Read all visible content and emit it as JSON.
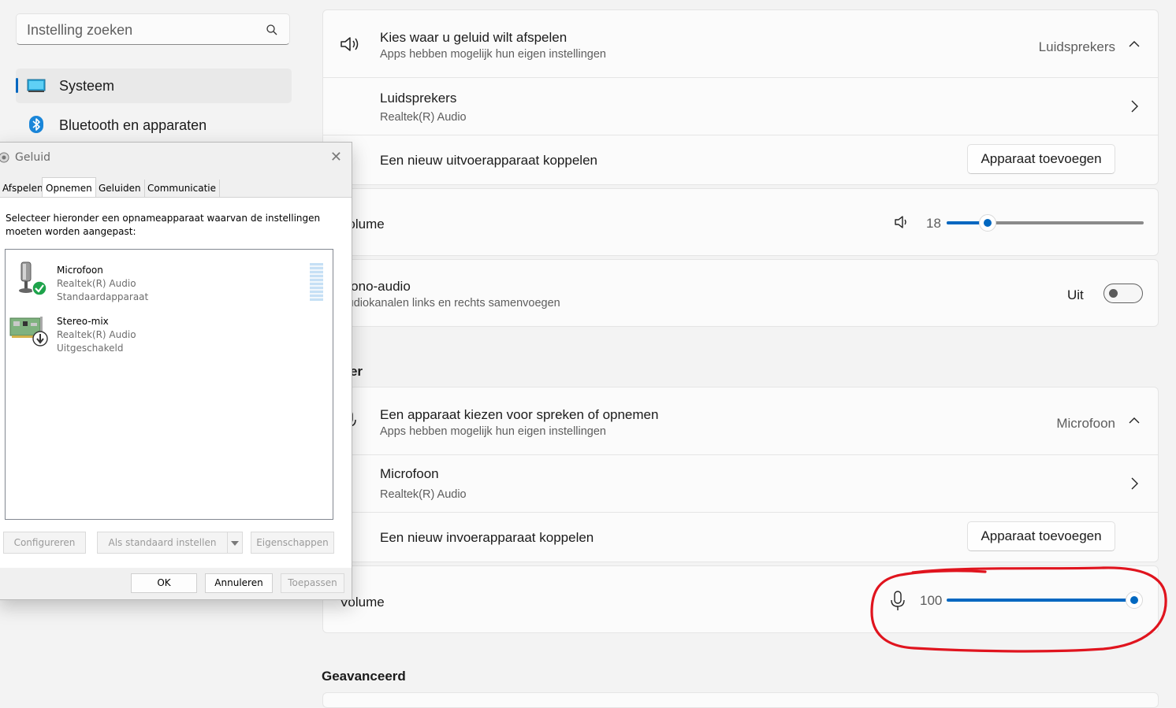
{
  "search": {
    "placeholder": "Instelling zoeken"
  },
  "nav": {
    "items": [
      {
        "label": "Systeem",
        "selected": true,
        "icon": "monitor-icon"
      },
      {
        "label": "Bluetooth en apparaten",
        "selected": false,
        "icon": "bluetooth-icon"
      }
    ]
  },
  "output": {
    "choose_title": "Kies waar u geluid wilt afspelen",
    "choose_subtitle": "Apps hebben mogelijk hun eigen instellingen",
    "choose_value": "Luidsprekers",
    "device_name": "Luidsprekers",
    "device_sub": "Realtek(R) Audio",
    "pair_label": "Een nieuw uitvoerapparaat koppelen",
    "pair_button": "Apparaat toevoegen",
    "volume_label": "Volume",
    "volume_value": "18",
    "mono_title": "Mono-audio",
    "mono_subtitle": "Audiokanalen links en rechts samenvoegen",
    "mono_state": "Uit"
  },
  "input": {
    "section_title": "Invoer",
    "choose_title": "Een apparaat kiezen voor spreken of opnemen",
    "choose_subtitle": "Apps hebben mogelijk hun eigen instellingen",
    "choose_value": "Microfoon",
    "device_name": "Microfoon",
    "device_sub": "Realtek(R) Audio",
    "pair_label": "Een nieuw invoerapparaat koppelen",
    "pair_button": "Apparaat toevoegen",
    "volume_label": "Volume",
    "volume_value": "100"
  },
  "advanced": {
    "section_title": "Geavanceerd"
  },
  "dialog": {
    "title": "Geluid",
    "tabs": [
      "Afspelen",
      "Opnemen",
      "Geluiden",
      "Communicatie"
    ],
    "active_tab": "Opnemen",
    "instruction": "Selecteer hieronder een opnameapparaat waarvan de instellingen moeten worden aangepast:",
    "devices": [
      {
        "name": "Microfoon",
        "driver": "Realtek(R) Audio",
        "status": "Standaardapparaat",
        "icon": "microphone-icon"
      },
      {
        "name": "Stereo-mix",
        "driver": "Realtek(R) Audio",
        "status": "Uitgeschakeld",
        "icon": "sound-card-icon"
      }
    ],
    "buttons": {
      "configure": "Configureren",
      "set_default": "Als standaard instellen",
      "properties": "Eigenschappen",
      "ok": "OK",
      "cancel": "Annuleren",
      "apply": "Toepassen"
    }
  },
  "annotation": {
    "color": "#e0141e"
  }
}
